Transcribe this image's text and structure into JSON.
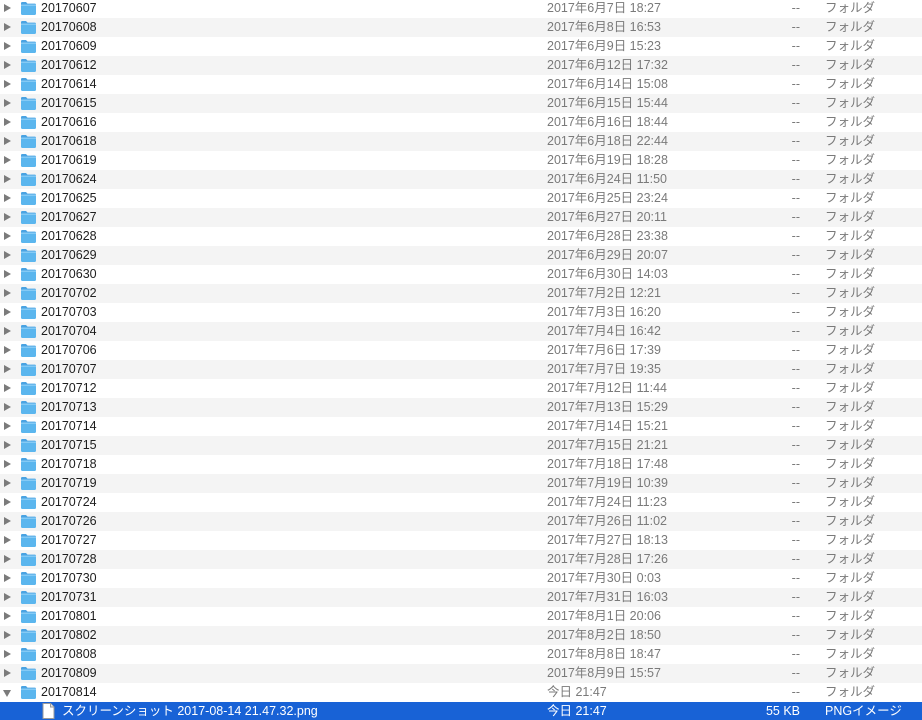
{
  "rows": [
    {
      "name": "20170607",
      "date": "2017年6月7日 18:27",
      "size": "--",
      "kind": "フォルダ",
      "type": "folder"
    },
    {
      "name": "20170608",
      "date": "2017年6月8日 16:53",
      "size": "--",
      "kind": "フォルダ",
      "type": "folder"
    },
    {
      "name": "20170609",
      "date": "2017年6月9日 15:23",
      "size": "--",
      "kind": "フォルダ",
      "type": "folder"
    },
    {
      "name": "20170612",
      "date": "2017年6月12日 17:32",
      "size": "--",
      "kind": "フォルダ",
      "type": "folder"
    },
    {
      "name": "20170614",
      "date": "2017年6月14日 15:08",
      "size": "--",
      "kind": "フォルダ",
      "type": "folder"
    },
    {
      "name": "20170615",
      "date": "2017年6月15日 15:44",
      "size": "--",
      "kind": "フォルダ",
      "type": "folder"
    },
    {
      "name": "20170616",
      "date": "2017年6月16日 18:44",
      "size": "--",
      "kind": "フォルダ",
      "type": "folder"
    },
    {
      "name": "20170618",
      "date": "2017年6月18日 22:44",
      "size": "--",
      "kind": "フォルダ",
      "type": "folder"
    },
    {
      "name": "20170619",
      "date": "2017年6月19日 18:28",
      "size": "--",
      "kind": "フォルダ",
      "type": "folder"
    },
    {
      "name": "20170624",
      "date": "2017年6月24日 11:50",
      "size": "--",
      "kind": "フォルダ",
      "type": "folder"
    },
    {
      "name": "20170625",
      "date": "2017年6月25日 23:24",
      "size": "--",
      "kind": "フォルダ",
      "type": "folder"
    },
    {
      "name": "20170627",
      "date": "2017年6月27日 20:11",
      "size": "--",
      "kind": "フォルダ",
      "type": "folder"
    },
    {
      "name": "20170628",
      "date": "2017年6月28日 23:38",
      "size": "--",
      "kind": "フォルダ",
      "type": "folder"
    },
    {
      "name": "20170629",
      "date": "2017年6月29日 20:07",
      "size": "--",
      "kind": "フォルダ",
      "type": "folder"
    },
    {
      "name": "20170630",
      "date": "2017年6月30日 14:03",
      "size": "--",
      "kind": "フォルダ",
      "type": "folder"
    },
    {
      "name": "20170702",
      "date": "2017年7月2日 12:21",
      "size": "--",
      "kind": "フォルダ",
      "type": "folder"
    },
    {
      "name": "20170703",
      "date": "2017年7月3日 16:20",
      "size": "--",
      "kind": "フォルダ",
      "type": "folder"
    },
    {
      "name": "20170704",
      "date": "2017年7月4日 16:42",
      "size": "--",
      "kind": "フォルダ",
      "type": "folder"
    },
    {
      "name": "20170706",
      "date": "2017年7月6日 17:39",
      "size": "--",
      "kind": "フォルダ",
      "type": "folder"
    },
    {
      "name": "20170707",
      "date": "2017年7月7日 19:35",
      "size": "--",
      "kind": "フォルダ",
      "type": "folder"
    },
    {
      "name": "20170712",
      "date": "2017年7月12日 11:44",
      "size": "--",
      "kind": "フォルダ",
      "type": "folder"
    },
    {
      "name": "20170713",
      "date": "2017年7月13日 15:29",
      "size": "--",
      "kind": "フォルダ",
      "type": "folder"
    },
    {
      "name": "20170714",
      "date": "2017年7月14日 15:21",
      "size": "--",
      "kind": "フォルダ",
      "type": "folder"
    },
    {
      "name": "20170715",
      "date": "2017年7月15日 21:21",
      "size": "--",
      "kind": "フォルダ",
      "type": "folder"
    },
    {
      "name": "20170718",
      "date": "2017年7月18日 17:48",
      "size": "--",
      "kind": "フォルダ",
      "type": "folder"
    },
    {
      "name": "20170719",
      "date": "2017年7月19日 10:39",
      "size": "--",
      "kind": "フォルダ",
      "type": "folder"
    },
    {
      "name": "20170724",
      "date": "2017年7月24日 11:23",
      "size": "--",
      "kind": "フォルダ",
      "type": "folder"
    },
    {
      "name": "20170726",
      "date": "2017年7月26日 11:02",
      "size": "--",
      "kind": "フォルダ",
      "type": "folder"
    },
    {
      "name": "20170727",
      "date": "2017年7月27日 18:13",
      "size": "--",
      "kind": "フォルダ",
      "type": "folder"
    },
    {
      "name": "20170728",
      "date": "2017年7月28日 17:26",
      "size": "--",
      "kind": "フォルダ",
      "type": "folder"
    },
    {
      "name": "20170730",
      "date": "2017年7月30日 0:03",
      "size": "--",
      "kind": "フォルダ",
      "type": "folder"
    },
    {
      "name": "20170731",
      "date": "2017年7月31日 16:03",
      "size": "--",
      "kind": "フォルダ",
      "type": "folder"
    },
    {
      "name": "20170801",
      "date": "2017年8月1日 20:06",
      "size": "--",
      "kind": "フォルダ",
      "type": "folder"
    },
    {
      "name": "20170802",
      "date": "2017年8月2日 18:50",
      "size": "--",
      "kind": "フォルダ",
      "type": "folder"
    },
    {
      "name": "20170808",
      "date": "2017年8月8日 18:47",
      "size": "--",
      "kind": "フォルダ",
      "type": "folder"
    },
    {
      "name": "20170809",
      "date": "2017年8月9日 15:57",
      "size": "--",
      "kind": "フォルダ",
      "type": "folder"
    },
    {
      "name": "20170814",
      "date": "今日 21:47",
      "size": "--",
      "kind": "フォルダ",
      "type": "folder",
      "expanded": true
    },
    {
      "name": "スクリーンショット 2017-08-14 21.47.32.png",
      "date": "今日 21:47",
      "size": "55 KB",
      "kind": "PNGイメージ",
      "type": "file",
      "selected": true
    }
  ],
  "colors": {
    "selection": "#1862d6",
    "alt_row": "#f4f4f4",
    "folder": "#5bb6ee",
    "secondary_text": "#7a7a7a"
  },
  "icons": {
    "folder": "folder-icon",
    "file": "document-icon",
    "collapsed": "disclosure-triangle-right-icon",
    "expanded": "disclosure-triangle-down-icon"
  }
}
